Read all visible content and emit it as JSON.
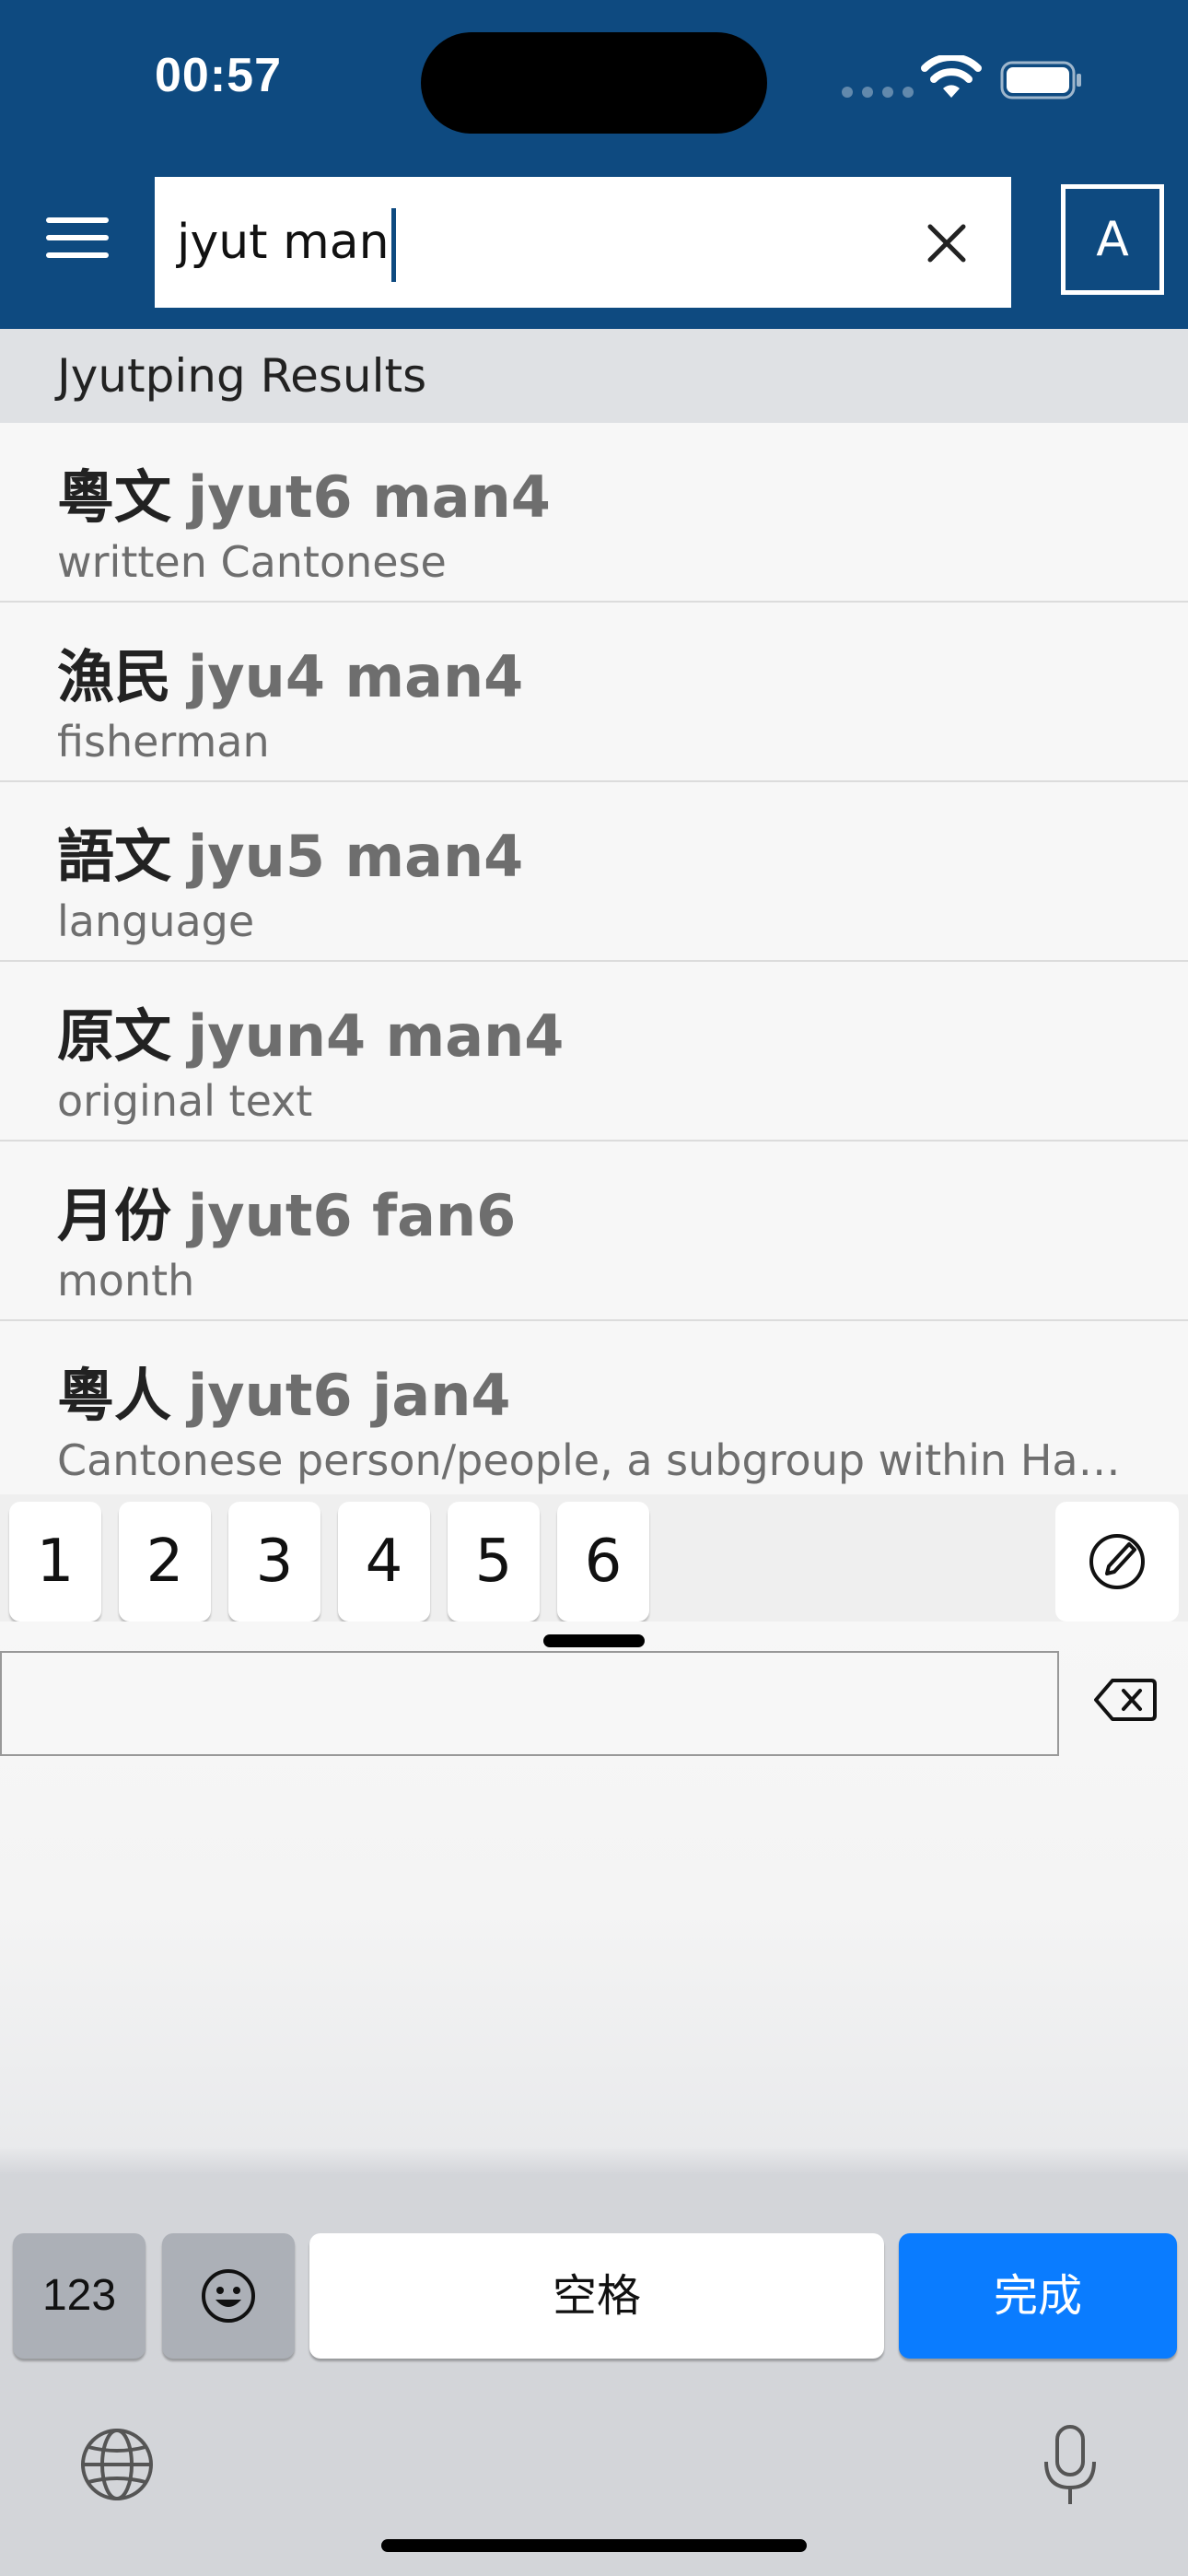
{
  "status_bar": {
    "time": "00:57"
  },
  "header": {
    "search_value": "jyut man",
    "language_button": "A"
  },
  "results": {
    "section_title": "Jyutping Results",
    "items": [
      {
        "hanzi": "粵文",
        "jyutping": "jyut6 man4",
        "gloss": "written Cantonese"
      },
      {
        "hanzi": "漁民",
        "jyutping": "jyu4 man4",
        "gloss": "fisherman"
      },
      {
        "hanzi": "語文",
        "jyutping": "jyu5 man4",
        "gloss": "language"
      },
      {
        "hanzi": "原文",
        "jyutping": "jyun4 man4",
        "gloss": "original text"
      },
      {
        "hanzi": "月份",
        "jyutping": "jyut6 fan6",
        "gloss": "month"
      },
      {
        "hanzi": "粵人",
        "jyutping": "jyut6 jan4",
        "gloss": "Cantonese person/people, a subgroup within Han …"
      }
    ]
  },
  "keyboard": {
    "tone_keys": [
      "1",
      "2",
      "3",
      "4",
      "5",
      "6"
    ],
    "numbers_key": "123",
    "space_key": "空格",
    "done_key": "完成",
    "done_color": "#0a7cff"
  },
  "colors": {
    "header_bg": "#0e4a80",
    "section_bg": "#dfe1e4"
  }
}
